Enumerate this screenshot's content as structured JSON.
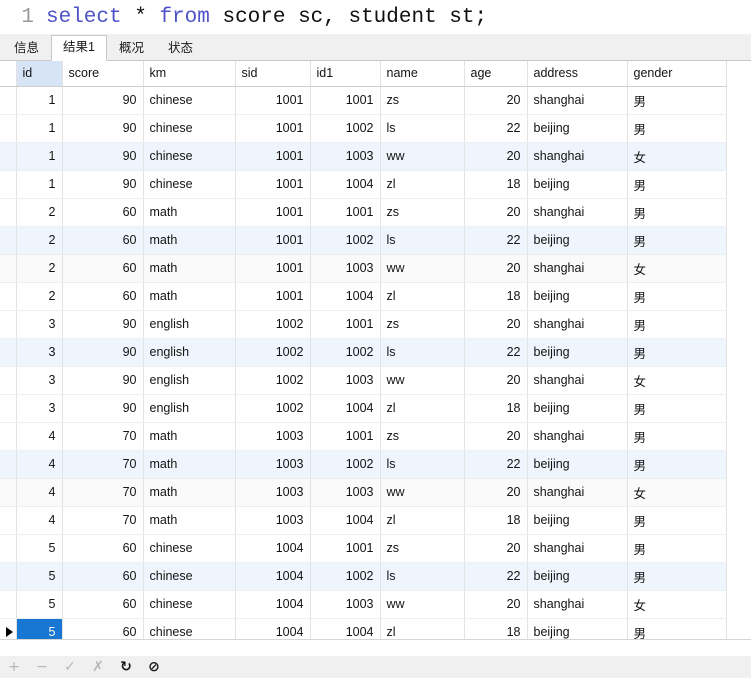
{
  "editor": {
    "line_number": "1",
    "tokens": [
      {
        "t": "select",
        "kw": true
      },
      {
        "t": " * ",
        "kw": false
      },
      {
        "t": "from",
        "kw": true
      },
      {
        "t": " score sc, student st;",
        "kw": false
      }
    ],
    "full_text": "select * from score sc, student st;"
  },
  "tabs": [
    {
      "label": "信息",
      "active": false
    },
    {
      "label": "结果1",
      "active": true
    },
    {
      "label": "概况",
      "active": false
    },
    {
      "label": "状态",
      "active": false
    }
  ],
  "grid": {
    "columns": [
      "id",
      "score",
      "km",
      "sid",
      "id1",
      "name",
      "age",
      "address",
      "gender"
    ],
    "highlighted_column": "id",
    "selected_cell": {
      "row": 19,
      "column": "id",
      "value": "5"
    },
    "rows": [
      {
        "id": "1",
        "score": "90",
        "km": "chinese",
        "sid": "1001",
        "id1": "1001",
        "name": "zs",
        "age": "20",
        "address": "shanghai",
        "gender": "男"
      },
      {
        "id": "1",
        "score": "90",
        "km": "chinese",
        "sid": "1001",
        "id1": "1002",
        "name": "ls",
        "age": "22",
        "address": "beijing",
        "gender": "男"
      },
      {
        "id": "1",
        "score": "90",
        "km": "chinese",
        "sid": "1001",
        "id1": "1003",
        "name": "ww",
        "age": "20",
        "address": "shanghai",
        "gender": "女"
      },
      {
        "id": "1",
        "score": "90",
        "km": "chinese",
        "sid": "1001",
        "id1": "1004",
        "name": "zl",
        "age": "18",
        "address": "beijing",
        "gender": "男"
      },
      {
        "id": "2",
        "score": "60",
        "km": "math",
        "sid": "1001",
        "id1": "1001",
        "name": "zs",
        "age": "20",
        "address": "shanghai",
        "gender": "男"
      },
      {
        "id": "2",
        "score": "60",
        "km": "math",
        "sid": "1001",
        "id1": "1002",
        "name": "ls",
        "age": "22",
        "address": "beijing",
        "gender": "男"
      },
      {
        "id": "2",
        "score": "60",
        "km": "math",
        "sid": "1001",
        "id1": "1003",
        "name": "ww",
        "age": "20",
        "address": "shanghai",
        "gender": "女"
      },
      {
        "id": "2",
        "score": "60",
        "km": "math",
        "sid": "1001",
        "id1": "1004",
        "name": "zl",
        "age": "18",
        "address": "beijing",
        "gender": "男"
      },
      {
        "id": "3",
        "score": "90",
        "km": "english",
        "sid": "1002",
        "id1": "1001",
        "name": "zs",
        "age": "20",
        "address": "shanghai",
        "gender": "男"
      },
      {
        "id": "3",
        "score": "90",
        "km": "english",
        "sid": "1002",
        "id1": "1002",
        "name": "ls",
        "age": "22",
        "address": "beijing",
        "gender": "男"
      },
      {
        "id": "3",
        "score": "90",
        "km": "english",
        "sid": "1002",
        "id1": "1003",
        "name": "ww",
        "age": "20",
        "address": "shanghai",
        "gender": "女"
      },
      {
        "id": "3",
        "score": "90",
        "km": "english",
        "sid": "1002",
        "id1": "1004",
        "name": "zl",
        "age": "18",
        "address": "beijing",
        "gender": "男"
      },
      {
        "id": "4",
        "score": "70",
        "km": "math",
        "sid": "1003",
        "id1": "1001",
        "name": "zs",
        "age": "20",
        "address": "shanghai",
        "gender": "男"
      },
      {
        "id": "4",
        "score": "70",
        "km": "math",
        "sid": "1003",
        "id1": "1002",
        "name": "ls",
        "age": "22",
        "address": "beijing",
        "gender": "男"
      },
      {
        "id": "4",
        "score": "70",
        "km": "math",
        "sid": "1003",
        "id1": "1003",
        "name": "ww",
        "age": "20",
        "address": "shanghai",
        "gender": "女"
      },
      {
        "id": "4",
        "score": "70",
        "km": "math",
        "sid": "1003",
        "id1": "1004",
        "name": "zl",
        "age": "18",
        "address": "beijing",
        "gender": "男"
      },
      {
        "id": "5",
        "score": "60",
        "km": "chinese",
        "sid": "1004",
        "id1": "1001",
        "name": "zs",
        "age": "20",
        "address": "shanghai",
        "gender": "男"
      },
      {
        "id": "5",
        "score": "60",
        "km": "chinese",
        "sid": "1004",
        "id1": "1002",
        "name": "ls",
        "age": "22",
        "address": "beijing",
        "gender": "男"
      },
      {
        "id": "5",
        "score": "60",
        "km": "chinese",
        "sid": "1004",
        "id1": "1003",
        "name": "ww",
        "age": "20",
        "address": "shanghai",
        "gender": "女"
      },
      {
        "id": "5",
        "score": "60",
        "km": "chinese",
        "sid": "1004",
        "id1": "1004",
        "name": "zl",
        "age": "18",
        "address": "beijing",
        "gender": "男"
      }
    ]
  },
  "toolbar": {
    "buttons": [
      {
        "name": "add-record-button",
        "glyph": "+",
        "enabled": false
      },
      {
        "name": "delete-record-button",
        "glyph": "−",
        "enabled": false
      },
      {
        "name": "apply-changes-button",
        "glyph": "✓",
        "enabled": false
      },
      {
        "name": "cancel-changes-button",
        "glyph": "✗",
        "enabled": false
      },
      {
        "name": "refresh-button",
        "glyph": "↻",
        "enabled": true
      },
      {
        "name": "stop-button",
        "glyph": "⊘",
        "enabled": true
      }
    ]
  },
  "colors": {
    "keyword": "#4f52c8",
    "selection": "#1877d2",
    "header_highlight": "#d6e4f5",
    "row_tint": "#eef5fc"
  }
}
